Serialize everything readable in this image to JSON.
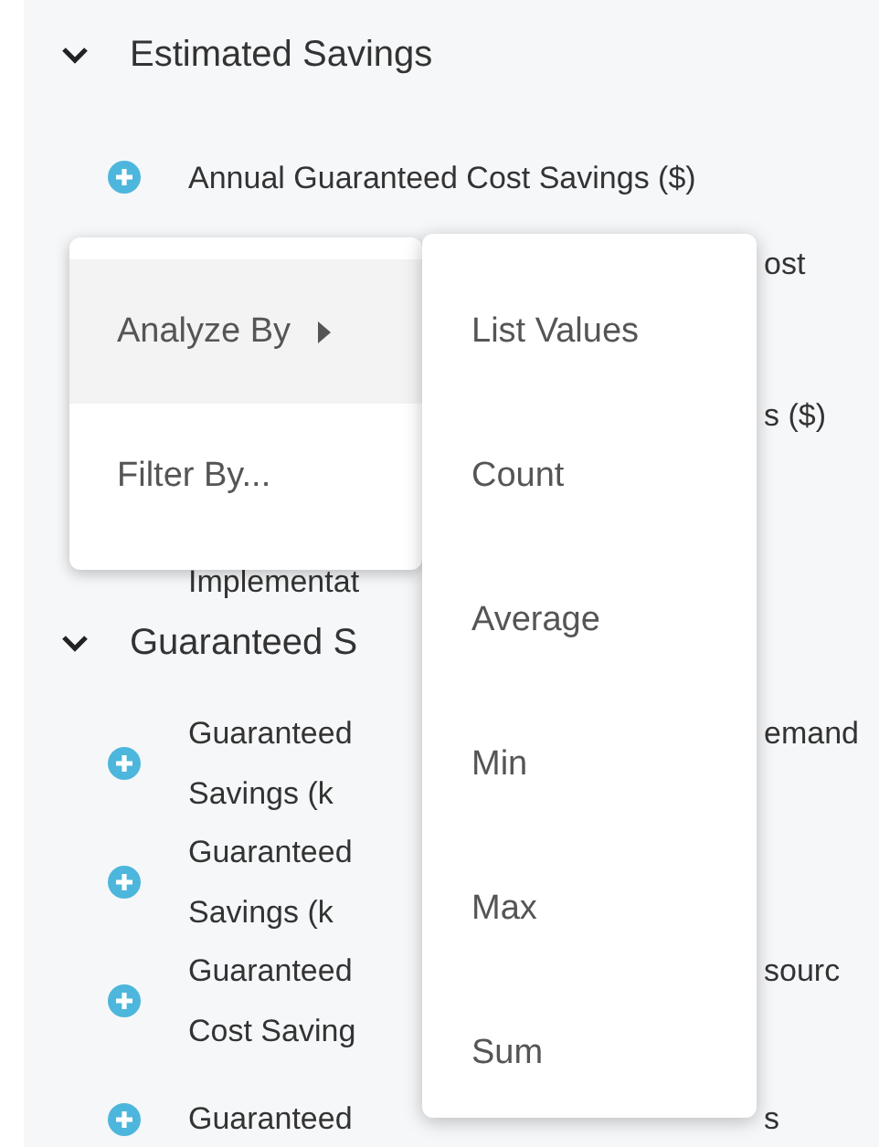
{
  "tree": [
    {
      "label": "Estimated Savings",
      "expanded": true,
      "items": [
        {
          "kind": "single",
          "icon": true,
          "lines": [
            {
              "left": "Annual Guaranteed Cost Savings ($)"
            }
          ]
        },
        {
          "kind": "double",
          "icon": false,
          "lines": [
            {
              "right": "ost"
            }
          ]
        },
        {
          "kind": "double",
          "icon": false,
          "lines": [
            {
              "right": "s ($)"
            }
          ]
        },
        {
          "kind": "cut",
          "icon": false,
          "lines": [
            {
              "left": "Implementat"
            }
          ]
        }
      ]
    },
    {
      "label": "Guaranteed S",
      "expanded": true,
      "items": [
        {
          "kind": "pair",
          "icon": true,
          "lines": [
            {
              "left": "Guaranteed",
              "right": "emand"
            },
            {
              "left": "Savings (k"
            }
          ]
        },
        {
          "kind": "pair",
          "icon": true,
          "lines": [
            {
              "left": "Guaranteed"
            },
            {
              "left": "Savings (k"
            }
          ]
        },
        {
          "kind": "pair",
          "icon": true,
          "lines": [
            {
              "left": "Guaranteed",
              "right": "sourc"
            },
            {
              "left": "Cost Saving"
            }
          ]
        },
        {
          "kind": "pair",
          "icon": true,
          "lines": [
            {
              "left": "Guaranteed",
              "right": "s"
            }
          ]
        }
      ]
    }
  ],
  "menu": {
    "items": [
      {
        "label": "Analyze By",
        "kind": "submenu",
        "selected": true
      },
      {
        "label": "Filter By...",
        "kind": "action",
        "selected": false
      }
    ]
  },
  "submenu": {
    "items": [
      "List Values",
      "Count",
      "Average",
      "Min",
      "Max",
      "Sum"
    ]
  }
}
